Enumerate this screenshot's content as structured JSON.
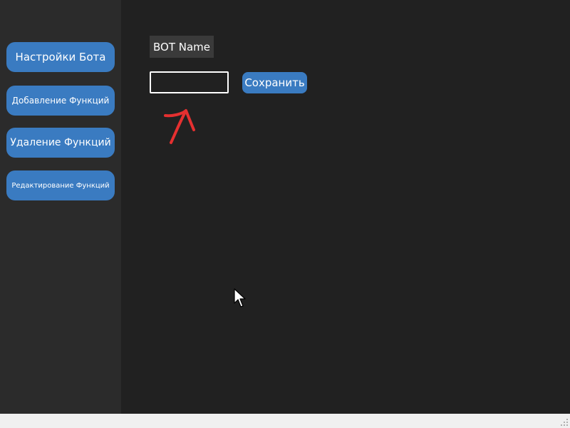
{
  "sidebar": {
    "items": [
      {
        "label": "Настройки Бота"
      },
      {
        "label": "Добавление Функций"
      },
      {
        "label": "Удаление Функций"
      },
      {
        "label": "Редактирование Функций"
      }
    ]
  },
  "main": {
    "name_label": "BOT Name",
    "name_input": {
      "value": "",
      "placeholder": ""
    },
    "save_label": "Сохранить"
  },
  "colors": {
    "background": "#212121",
    "sidebar_background": "#2b2b2b",
    "accent": "#3a7bc1",
    "label_background": "#3a3a3a",
    "annotation": "#e53030",
    "status_bar": "#f0f0f0"
  },
  "icons": {
    "annotation": "red-hand-drawn-arrow-icon",
    "pointer": "mouse-cursor-icon",
    "grip": "size-grip-icon"
  }
}
